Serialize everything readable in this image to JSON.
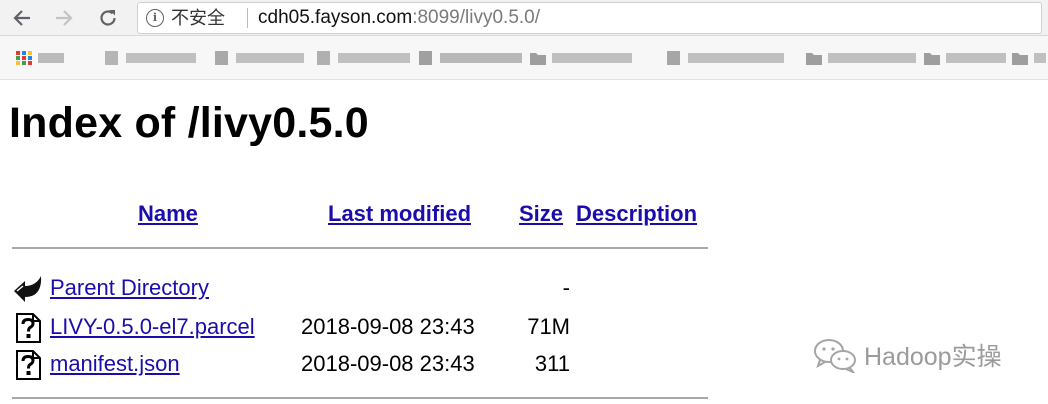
{
  "browser": {
    "insecure_label": "不安全",
    "url_host": "cdh05.fayson.com",
    "url_rest": ":8099/livy0.5.0/"
  },
  "page": {
    "title": "Index of /livy0.5.0",
    "columns": {
      "name": "Name",
      "last_modified": "Last modified",
      "size": "Size",
      "description": "Description"
    },
    "rows": [
      {
        "icon": "back-arrow-icon",
        "name": "Parent Directory",
        "modified": "",
        "size": "-"
      },
      {
        "icon": "unknown-file-icon",
        "name": "LIVY-0.5.0-el7.parcel",
        "modified": "2018-09-08 23:43",
        "size": "71M"
      },
      {
        "icon": "unknown-file-icon",
        "name": "manifest.json",
        "modified": "2018-09-08 23:43",
        "size": "311"
      }
    ]
  },
  "watermark": {
    "text": "Hadoop实操"
  }
}
